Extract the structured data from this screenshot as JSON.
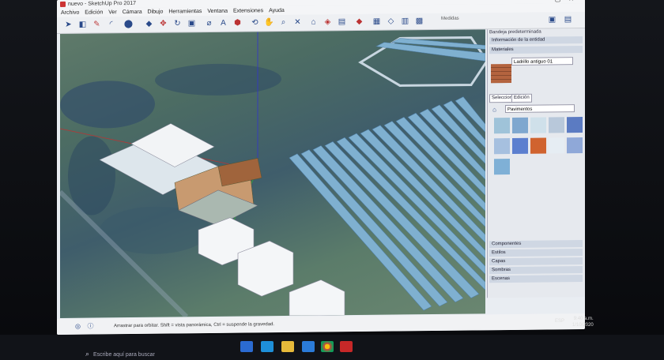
{
  "window": {
    "title": "nuevo - SketchUp Pro 2017"
  },
  "menu": [
    "Archivo",
    "Edición",
    "Ver",
    "Cámara",
    "Dibujo",
    "Herramientas",
    "Ventana",
    "Extensiones",
    "Ayuda"
  ],
  "toolbar": {
    "measurements_label": "Medidas"
  },
  "tray": {
    "title": "Bandeja predeterminada",
    "sections": {
      "entity_info": "Información de la entidad",
      "materials": "Materiales"
    },
    "material_name": "Ladrillo antiguo 01",
    "tabs": {
      "select": "Seleccionar",
      "edit": "Edición"
    },
    "category": "Pavimentos",
    "collapsed": [
      "Componentes",
      "Estilos",
      "Capas",
      "Sombras",
      "Escenas"
    ]
  },
  "status": {
    "hint": "Arrastrar para orbitar. Shift = vista panorámica, Ctrl = suspende la gravedad."
  },
  "taskbar": {
    "search_placeholder": "Escribe aquí para buscar",
    "time": "9:40 a.m.",
    "date": "1/10/2020",
    "lang": "ESP"
  },
  "colors": {
    "swatches": [
      "#9fc3d9",
      "#7fa7cf",
      "#cfe0ea",
      "#b8c8da",
      "#5b7bc2",
      "#a6c0df",
      "#5c7fcf",
      "#d0632f",
      "#e6edf3",
      "#8fa8d8",
      "#7fb0d6"
    ]
  }
}
